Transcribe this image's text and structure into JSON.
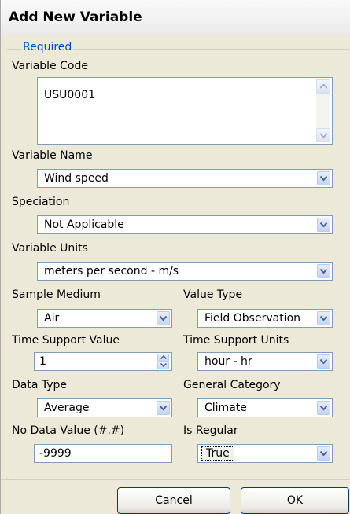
{
  "dialog": {
    "title": "Add New Variable",
    "group_label": "Required"
  },
  "fields": {
    "variable_code": {
      "label": "Variable Code",
      "value": "USU0001"
    },
    "variable_name": {
      "label": "Variable Name",
      "value": "Wind speed"
    },
    "speciation": {
      "label": "Speciation",
      "value": "Not Applicable"
    },
    "variable_units": {
      "label": "Variable Units",
      "value": "meters per second - m/s"
    },
    "sample_medium": {
      "label": "Sample Medium",
      "value": "Air"
    },
    "value_type": {
      "label": "Value Type",
      "value": "Field Observation"
    },
    "time_support_value": {
      "label": "Time Support Value",
      "value": "1"
    },
    "time_support_units": {
      "label": "Time Support Units",
      "value": "hour - hr"
    },
    "data_type": {
      "label": "Data Type",
      "value": "Average"
    },
    "general_category": {
      "label": "General Category",
      "value": "Climate"
    },
    "no_data_value": {
      "label": "No Data Value (#.#)",
      "value": "-9999"
    },
    "is_regular": {
      "label": "Is Regular",
      "value": "True"
    }
  },
  "buttons": {
    "cancel": "Cancel",
    "ok": "OK"
  },
  "colors": {
    "group_label": "#0046d5",
    "input_border": "#7f9db9",
    "background": "#ece9d8"
  }
}
